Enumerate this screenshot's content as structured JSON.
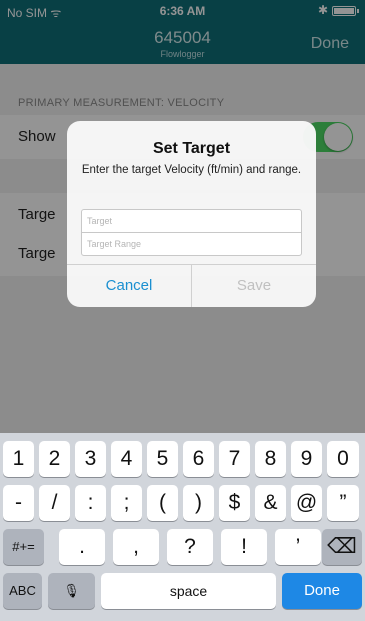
{
  "status_bar": {
    "carrier": "No SIM ᯤ",
    "time": "6:36 AM",
    "bluetooth": "✱"
  },
  "nav": {
    "title": "645004",
    "subtitle": "Flowlogger",
    "done_label": "Done"
  },
  "settings": {
    "section_header": "PRIMARY MEASUREMENT: VELOCITY",
    "rows": [
      {
        "label": "Show",
        "switch_on": true
      },
      {
        "label": "Targe"
      },
      {
        "label": "Targe"
      }
    ]
  },
  "alert": {
    "title": "Set Target",
    "message": "Enter the target Velocity (ft/min) and range.",
    "target_placeholder": "Target",
    "range_placeholder": "Target Range",
    "cancel_label": "Cancel",
    "save_label": "Save"
  },
  "keyboard": {
    "row1": [
      "1",
      "2",
      "3",
      "4",
      "5",
      "6",
      "7",
      "8",
      "9",
      "0"
    ],
    "row2": [
      "-",
      "/",
      ":",
      ";",
      "(",
      ")",
      "$",
      "&",
      "@",
      "”"
    ],
    "row3_left": "#+=",
    "row3": [
      ".",
      ",",
      "?",
      "!",
      "’"
    ],
    "delete_icon": "⌫",
    "abc_label": "ABC",
    "mic_icon": "🎙",
    "space_label": "space",
    "done_label": "Done"
  }
}
